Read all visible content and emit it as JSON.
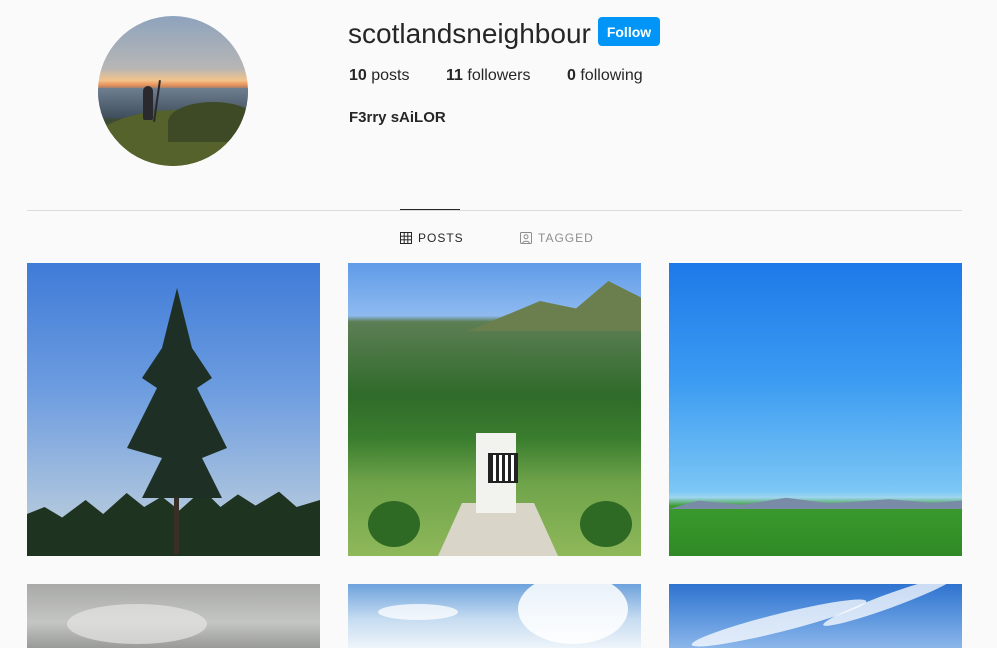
{
  "profile": {
    "username": "scotlandsneighbour",
    "follow_label": "Follow",
    "full_name": "F3rry sAiLOR",
    "stats": {
      "posts_count": "10",
      "posts_label": "posts",
      "followers_count": "11",
      "followers_label": "followers",
      "following_count": "0",
      "following_label": "following"
    }
  },
  "tabs": [
    {
      "label": "POSTS",
      "icon": "grid-icon",
      "active": true
    },
    {
      "label": "TAGGED",
      "icon": "tag-person-icon",
      "active": false
    }
  ],
  "colors": {
    "accent": "#0095f6",
    "text": "#262626",
    "muted": "#8e8e8e",
    "divider": "#dbdbdb",
    "background": "#fafafa"
  }
}
